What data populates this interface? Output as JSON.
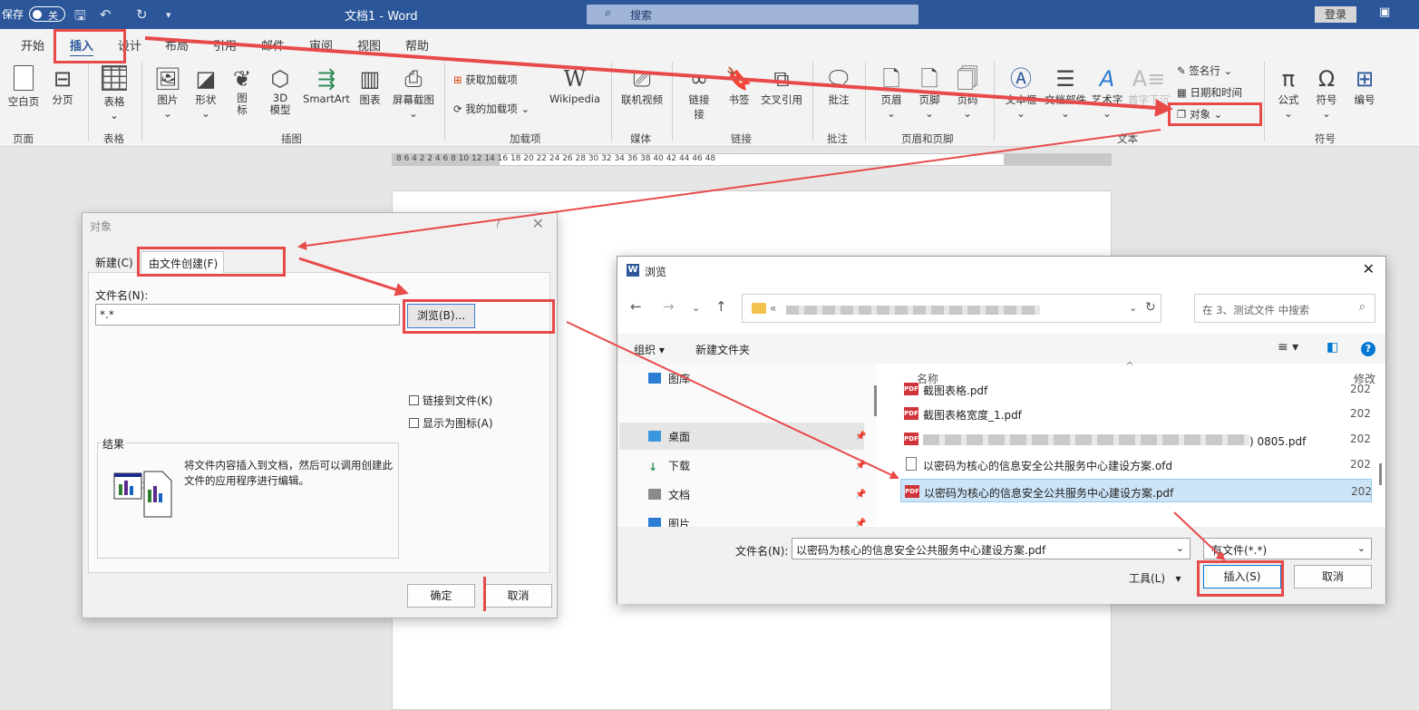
{
  "titlebar": {
    "autosave": "保存",
    "autosave_state": "关",
    "title": "文档1 - Word",
    "search_placeholder": "搜索",
    "login": "登录"
  },
  "tabs": [
    "开始",
    "插入",
    "设计",
    "布局",
    "引用",
    "邮件",
    "审阅",
    "视图",
    "帮助"
  ],
  "active_tab": "插入",
  "ribbon": {
    "pages": [
      "空白页",
      "分页"
    ],
    "group_pages": "页面",
    "table": "表格",
    "group_table": "表格",
    "illustrations": [
      "图片",
      "形状",
      "图标",
      "3D模型",
      "SmartArt",
      "图表",
      "屏幕截图"
    ],
    "group_illustrations": "插图",
    "addin_get": "获取加载项",
    "addin_my": "我的加载项",
    "wikipedia": "Wikipedia",
    "group_addins": "加载项",
    "online_video": "联机视频",
    "group_media": "媒体",
    "links": [
      "链接",
      "书签",
      "交叉引用"
    ],
    "group_links": "链接",
    "comment": "批注",
    "group_comments": "批注",
    "header_footer": [
      "页眉",
      "页脚",
      "页码"
    ],
    "group_header_footer": "页眉和页脚",
    "text_items": [
      "文本框",
      "文档部件",
      "艺术字",
      "首字下沉"
    ],
    "signature": "签名行",
    "datetime": "日期和时间",
    "object": "对象",
    "group_text": "文本",
    "symbols": [
      "公式",
      "符号",
      "编号"
    ],
    "group_symbols": "符号"
  },
  "ruler": "8   6   4   2        2   4   6   8   10   12   14   16   18   20   22   24   26   28   30   32   34   36   38    40   42   44   46   48",
  "object_dialog": {
    "title": "对象",
    "help": "?",
    "tab_new": "新建(C)",
    "tab_from_file": "由文件创建(F)",
    "filename_label": "文件名(N):",
    "filename_value": "*.*",
    "browse": "浏览(B)...",
    "link_to_file": "链接到文件(K)",
    "show_as_icon": "显示为图标(A)",
    "result_label": "结果",
    "result_text": "将文件内容插入到文档，然后可以调用创建此文件的应用程序进行编辑。",
    "ok": "确定",
    "cancel": "取消"
  },
  "browse_dialog": {
    "title": "浏览",
    "search_placeholder": "在 3、测试文件 中搜索",
    "organize": "组织",
    "new_folder": "新建文件夹",
    "nav_items": [
      "图库",
      "桌面",
      "下载",
      "文档",
      "图片"
    ],
    "col_name": "名称",
    "col_modified": "修改",
    "files": [
      {
        "name": "截图表格.pdf",
        "type": "pdf",
        "date": "202"
      },
      {
        "name": "截图表格宽度_1.pdf",
        "type": "pdf",
        "date": "202"
      },
      {
        "name": ") 0805.pdf",
        "type": "pdf",
        "date": "202"
      },
      {
        "name": "以密码为核心的信息安全公共服务中心建设方案.ofd",
        "type": "ofd",
        "date": "202"
      },
      {
        "name": "以密码为核心的信息安全公共服务中心建设方案.pdf",
        "type": "pdf",
        "date": "202",
        "selected": true
      }
    ],
    "filename_label": "文件名(N):",
    "filename_value": "以密码为核心的信息安全公共服务中心建设方案.pdf",
    "filetype": "有文件(*.*)",
    "tools": "工具(L)",
    "insert": "插入(S)",
    "cancel": "取消"
  },
  "colors": {
    "accent": "#2b579a",
    "highlight": "#e84a4a"
  }
}
